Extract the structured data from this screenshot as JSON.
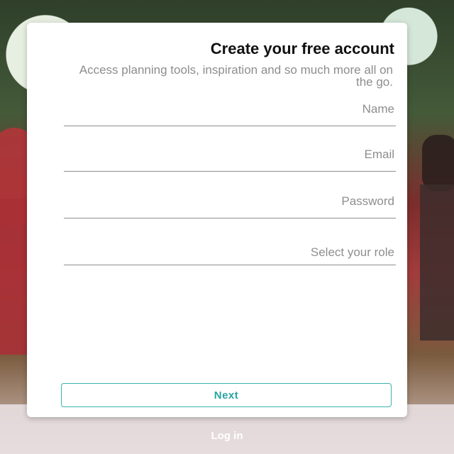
{
  "card": {
    "title": "Create your free account",
    "subtitle": "Access planning tools, inspiration and so much more all on the go."
  },
  "form": {
    "name_placeholder": "Name",
    "email_placeholder": "Email",
    "password_placeholder": "Password",
    "role_placeholder": "Select your role",
    "next_label": "Next"
  },
  "footer": {
    "login_label": "Log in"
  },
  "colors": {
    "accent": "#29a59f",
    "card_bg": "#ffffff"
  }
}
